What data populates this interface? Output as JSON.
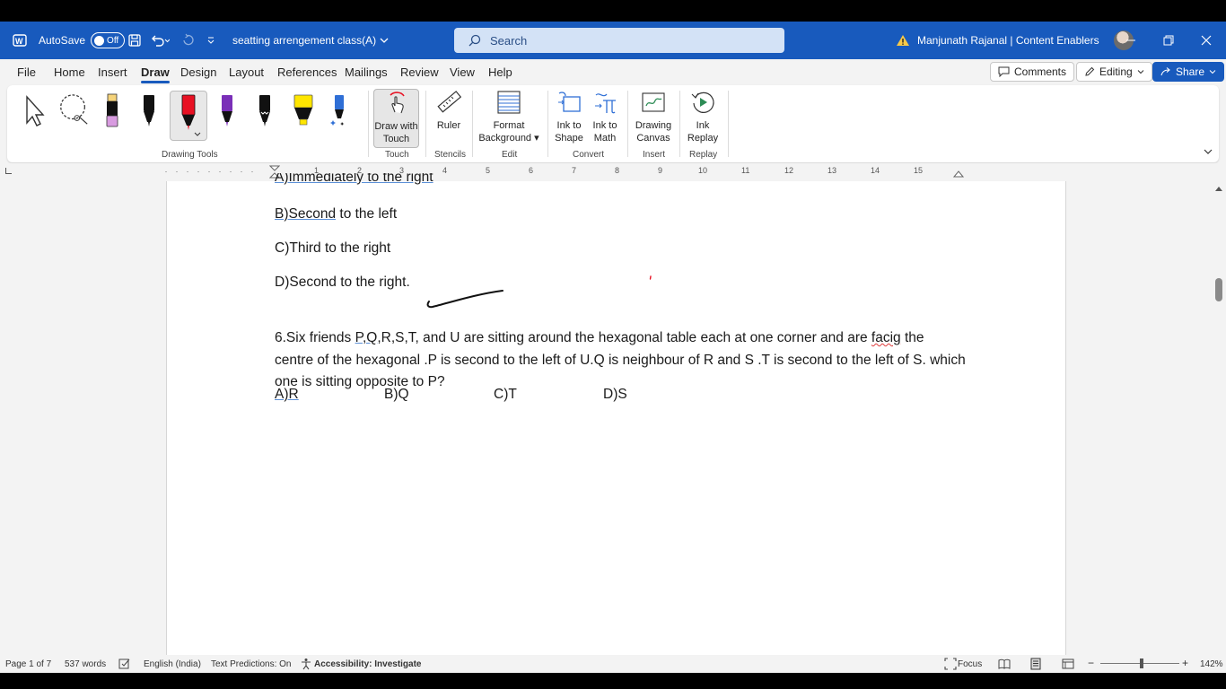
{
  "titlebar": {
    "autosave_label": "AutoSave",
    "autosave_state": "Off",
    "doc_title": "seatting arrengement class(A)",
    "search_placeholder": "Search",
    "user_name": "Manjunath Rajanal | Content Enablers"
  },
  "menu": {
    "tabs": [
      "File",
      "Home",
      "Insert",
      "Draw",
      "Design",
      "Layout",
      "References",
      "Mailings",
      "Review",
      "View",
      "Help"
    ],
    "active_tab": "Draw",
    "comments_label": "Comments",
    "editing_label": "Editing",
    "share_label": "Share"
  },
  "ribbon": {
    "groups": {
      "drawing_tools": "Drawing Tools",
      "touch": "Touch",
      "stencils": "Stencils",
      "edit": "Edit",
      "convert": "Convert",
      "insert": "Insert",
      "replay": "Replay"
    },
    "buttons": {
      "draw_touch_1": "Draw with",
      "draw_touch_2": "Touch",
      "ruler": "Ruler",
      "format_bg_1": "Format",
      "format_bg_2": "Background",
      "ink_shape_1": "Ink to",
      "ink_shape_2": "Shape",
      "ink_math_1": "Ink to",
      "ink_math_2": "Math",
      "drawing_canvas_1": "Drawing",
      "drawing_canvas_2": "Canvas",
      "ink_replay_1": "Ink",
      "ink_replay_2": "Replay"
    }
  },
  "ruler": {
    "numbers": [
      "1",
      "2",
      "3",
      "4",
      "5",
      "6",
      "7",
      "8",
      "9",
      "10",
      "11",
      "12",
      "13",
      "14",
      "15"
    ]
  },
  "document": {
    "line_a": "A)Immediately to the right",
    "line_b_prefix": "B)Second",
    "line_b_rest": " to the left",
    "line_c": "C)Third to the right",
    "line_d": "D)Second to the right.",
    "q6_part1": "6.Six friends ",
    "q6_underlined": "P,Q",
    "q6_part2": ",R,S,T, and U are sitting around the hexagonal table each at one corner and are ",
    "q6_misspelled": "facig",
    "q6_part3": " the centre of the hexagonal .P is second to the left of U.Q is neighbour of R and S .T is second to the left of S. which one is sitting opposite to P?",
    "options": [
      "A)R",
      "B)Q",
      "C)T",
      "D)S"
    ]
  },
  "status": {
    "page": "Page 1 of 7",
    "words": "537 words",
    "language": "English (India)",
    "text_predictions": "Text Predictions: On",
    "accessibility": "Accessibility: Investigate",
    "focus": "Focus",
    "zoom": "142%"
  },
  "colors": {
    "brand": "#185abd",
    "pen_red": "#e81123",
    "pen_purple": "#7a2fb8",
    "highlighter_yellow": "#ffe600"
  },
  "icons": [
    "word-icon",
    "save-icon",
    "undo-icon",
    "redo-icon",
    "search-icon",
    "warning-icon",
    "minimize-icon",
    "restore-icon",
    "close-icon",
    "select-icon",
    "lasso-icon",
    "pen-icon",
    "highlighter-icon",
    "touch-icon",
    "ruler-icon",
    "format-background-icon",
    "ink-to-shape-icon",
    "ink-to-math-icon",
    "drawing-canvas-icon",
    "ink-replay-icon",
    "focus-icon",
    "read-mode-icon",
    "print-layout-icon",
    "web-layout-icon"
  ]
}
